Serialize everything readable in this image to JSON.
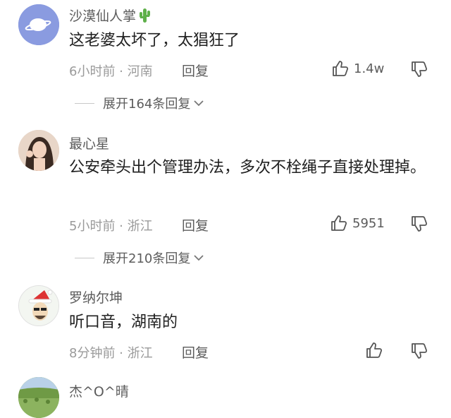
{
  "comments": [
    {
      "username": "沙漠仙人掌",
      "text": "这老婆太坏了，太猖狂了",
      "meta": "6小时前 · 河南",
      "reply_label": "回复",
      "likes": "1.4w",
      "expand_label": "展开164条回复"
    },
    {
      "username": "最心星",
      "text": "公安牵头出个管理办法，多次不栓绳子直接处理掉。",
      "meta": "5小时前 · 浙江",
      "reply_label": "回复",
      "likes": "5951",
      "expand_label": "展开210条回复"
    },
    {
      "username": "罗纳尔坤",
      "text": "听口音，湖南的",
      "meta": "8分钟前 · 浙江",
      "reply_label": "回复",
      "likes": ""
    },
    {
      "username": "杰^O^晴"
    }
  ],
  "colors": {
    "username": "#5c5c5c",
    "text": "#1f1f1f",
    "meta": "#9a9a9a"
  },
  "icons": [
    "thumbs-up-icon",
    "thumbs-down-icon",
    "chevron-down-icon",
    "cactus-emoji"
  ]
}
